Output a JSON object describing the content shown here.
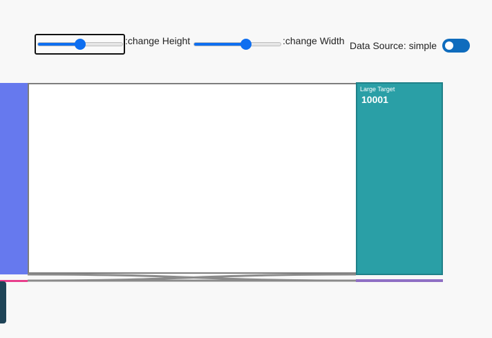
{
  "controls": {
    "height_slider": {
      "label": ":change Height",
      "value_fraction": 0.5
    },
    "width_slider": {
      "label": ":change Width",
      "value_fraction": 0.6
    },
    "data_source": {
      "label": "Data Source: simple",
      "toggle_on": false
    }
  },
  "sankey": {
    "target_node": {
      "name": "Large Target",
      "value": "10001"
    }
  },
  "colors": {
    "accent": "#0f6ff0",
    "toggle": "#0f6cbd",
    "left_node": "#6679ee",
    "target_node": "#2a9fa6",
    "link_border": "#7d7d7d",
    "small_link_pink": "#e83e8c",
    "small_link_purple": "#8f6fc4"
  }
}
